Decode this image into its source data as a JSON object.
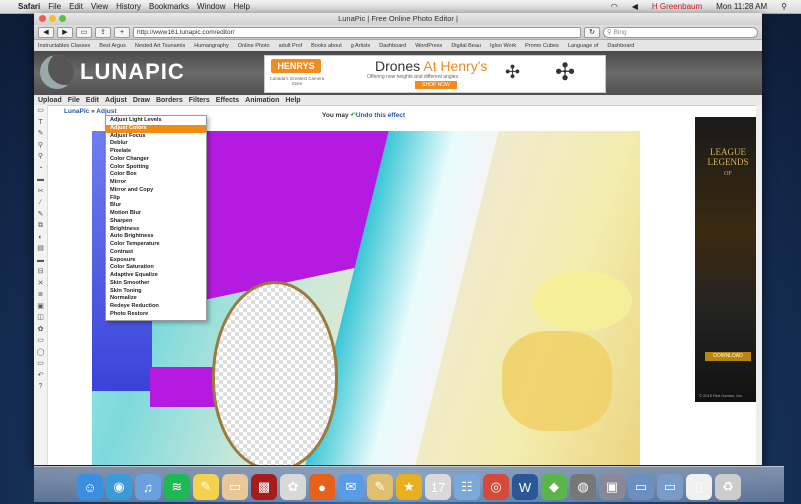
{
  "menubar": {
    "items": [
      "Safari",
      "File",
      "Edit",
      "View",
      "History",
      "Bookmarks",
      "Window",
      "Help"
    ],
    "clock": "Mon 11:28 AM",
    "user": "H Greenbaum"
  },
  "browser": {
    "window_title": "LunaPic | Free Online Photo Editor |",
    "url": "http://www161.lunapic.com/editor/",
    "search_placeholder": "Bing",
    "bookmarks": [
      "Instructables Classes",
      "Best Argus",
      "Nested Art Tsunamis",
      "Humangraphy",
      "Online Photo",
      "adult Prof",
      "Books about",
      "g Artists",
      "Dashboard",
      "WordPress",
      "Digital Beau",
      "Igloo Work",
      "Promo Cubes",
      "Language of",
      "Dashboard"
    ]
  },
  "site": {
    "logo": "LUNAPIC",
    "ad": {
      "brand": "HENRYS",
      "brand_sub": "Canada's Greatest Camera Store",
      "headline_a": "Drones ",
      "headline_b": "At Henry's",
      "sub": "Offering new heights and different angles.",
      "cta": "SHOP NOW"
    },
    "menu": [
      "Upload",
      "File",
      "Edit",
      "Adjust",
      "Draw",
      "Borders",
      "Filters",
      "Effects",
      "Animation",
      "Help"
    ],
    "breadcrumb_root": "LunaPic",
    "breadcrumb_sep": " » ",
    "breadcrumb_current": "Adjust",
    "undo_prefix": "You may ",
    "undo_link": "Undo this effect",
    "sidead": {
      "title": "LEAGUE LEGENDS",
      "of": "OF",
      "cta": "DOWNLOAD",
      "foot": "© 2015 Riot Games, Inc."
    }
  },
  "dropdown": {
    "selected": "Adjust Colors",
    "items": [
      "Adjust Light Levels",
      "Adjust Colors",
      "Adjust Focus",
      "Deblur",
      "Pixelate",
      "Color Changer",
      "Color Spotting",
      "Color Box",
      "Mirror",
      "Mirror and Copy",
      "Flip",
      "Blur",
      "Motion Blur",
      "Sharpen",
      "Brightness",
      "Auto Brightness",
      "Color Temperature",
      "Contrast",
      "Exposure",
      "Color Saturation",
      "Adaptive Equalize",
      "Skin Smoother",
      "Skin Toning",
      "Normalize",
      "Redeye Reduction",
      "Photo Restore"
    ]
  },
  "tools": [
    "▭",
    "T",
    "✎",
    "⚲",
    "⚲",
    "◔",
    "▬",
    "✂",
    "∕",
    "✎",
    "⧉",
    "◐",
    "▤",
    "▬",
    "⊟",
    "✕",
    "⧈",
    "▣",
    "◫",
    "✿",
    "▭",
    "◯",
    "▭",
    "↶",
    "?"
  ],
  "dock": {
    "icons": [
      "finder-icon",
      "safari-icon",
      "itunes-icon",
      "spotify-icon",
      "notes-icon",
      "preview-icon",
      "photo-booth-icon",
      "photos-icon",
      "firefox-icon",
      "mail-icon",
      "pencil-icon",
      "yellow-folder-icon",
      "calendar-icon",
      "contacts-icon",
      "chrome-icon",
      "word-icon",
      "evernote-icon",
      "camera-icon",
      "app-icon",
      "downloads-icon",
      "documents-icon",
      "file-icon",
      "trash-icon"
    ],
    "glyphs": [
      "☺",
      "◉",
      "♫",
      "≋",
      "✎",
      "▭",
      "▩",
      "✿",
      "●",
      "✉",
      "✎",
      "★",
      "17",
      "☷",
      "◎",
      "W",
      "◆",
      "◍",
      "▣",
      "▭",
      "▭",
      "▯",
      "♻"
    ],
    "colors": [
      "#3b8fe0",
      "#3a9bd8",
      "#6aa0e0",
      "#1db954",
      "#f5d14e",
      "#e8c79b",
      "#a61c1c",
      "#d8d8d8",
      "#e8611a",
      "#5a9be6",
      "#e0c070",
      "#e8b020",
      "#d9d9d9",
      "#7aa8d8",
      "#d44a3b",
      "#2b5797",
      "#5bb54a",
      "#777",
      "#889",
      "#6a8fc0",
      "#7a9ac8",
      "#f0f0f0",
      "#ccc"
    ]
  },
  "colors": {
    "accent": "#f08c14",
    "purple": "#b41ae0",
    "cyan": "#39c6d6",
    "link": "#2255aa"
  }
}
